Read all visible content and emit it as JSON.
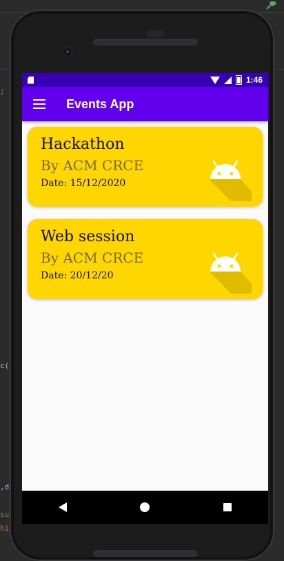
{
  "status_bar": {
    "time": "1:46"
  },
  "app_bar": {
    "title": "Events App"
  },
  "events": [
    {
      "title": "Hackathon",
      "organizer": "By ACM CRCE",
      "date": "Date: 15/12/2020"
    },
    {
      "title": "Web session",
      "organizer": "By ACM CRCE",
      "date": "Date: 20/12/20"
    }
  ],
  "ide_background": {
    "fragments": [
      ";",
      "c(",
      ",d",
      "suc",
      "hi"
    ]
  },
  "colors": {
    "status_bar": "#3700b3",
    "app_bar": "#6200ee",
    "card": "#ffd600",
    "android_green": "#ffffff"
  },
  "icons": [
    "sim-card-icon",
    "wifi-icon",
    "signal-icon",
    "battery-icon",
    "menu-icon",
    "android-icon",
    "back-icon",
    "home-icon",
    "recents-icon"
  ]
}
